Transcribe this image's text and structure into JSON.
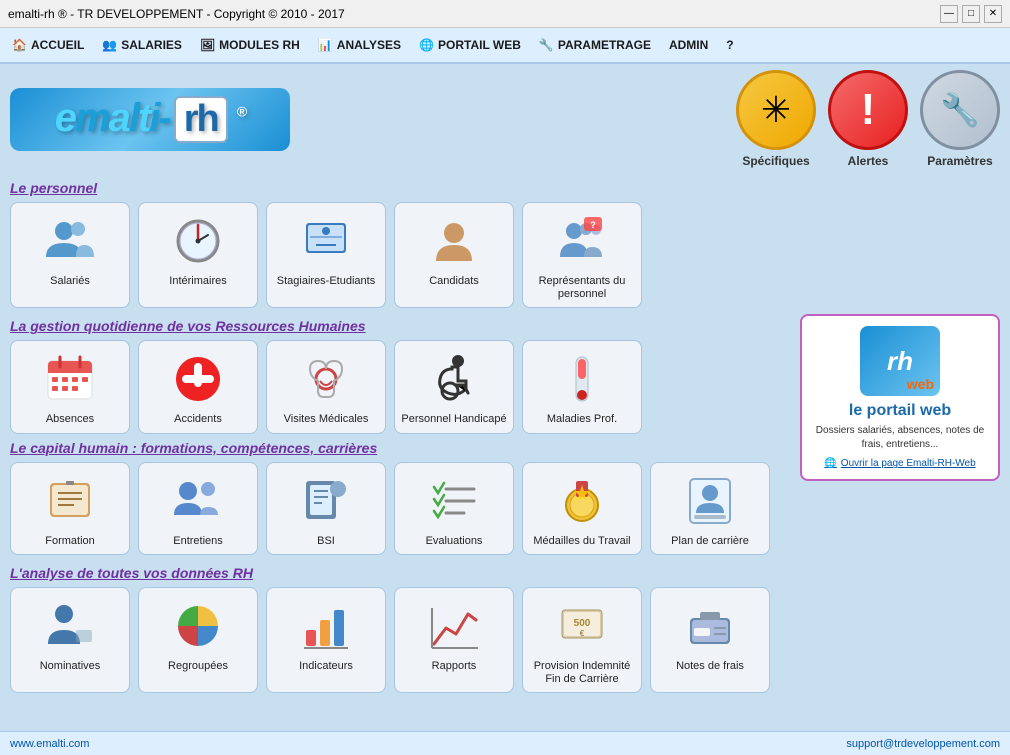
{
  "titlebar": {
    "title": "emalti-rh ® - TR DEVELOPPEMENT - Copyright © 2010 - 2017"
  },
  "titlebar_buttons": {
    "minimize": "—",
    "maximize": "□",
    "close": "✕"
  },
  "menu": {
    "items": [
      {
        "id": "accueil",
        "label": "ACCUEIL",
        "icon": "🏠"
      },
      {
        "id": "salaries",
        "label": "SALARIES",
        "icon": "👥"
      },
      {
        "id": "modules_rh",
        "label": "MODULES RH",
        "icon": "🖼"
      },
      {
        "id": "analyses",
        "label": "ANALYSES",
        "icon": "📊"
      },
      {
        "id": "portail_web",
        "label": "PORTAIL WEB",
        "icon": "🌐"
      },
      {
        "id": "parametrage",
        "label": "PARAMETRAGE",
        "icon": "🔧"
      },
      {
        "id": "admin",
        "label": "ADMIN",
        "icon": ""
      },
      {
        "id": "help",
        "label": "?",
        "icon": ""
      }
    ]
  },
  "quick_buttons": [
    {
      "id": "specifiques",
      "label": "Spécifiques",
      "icon": "✳",
      "class": "specifiques"
    },
    {
      "id": "alertes",
      "label": "Alertes",
      "icon": "❗",
      "class": "alertes"
    },
    {
      "id": "parametres",
      "label": "Paramètres",
      "icon": "🔧",
      "class": "parametres"
    }
  ],
  "sections": {
    "personnel": {
      "header": "Le personnel",
      "tiles": [
        {
          "id": "salaries",
          "label": "Salariés",
          "icon": "👥"
        },
        {
          "id": "interimaires",
          "label": "Intérimaires",
          "icon": "🕐"
        },
        {
          "id": "stagiaires",
          "label": "Stagiaires-Etudiants",
          "icon": "🎓"
        },
        {
          "id": "candidats",
          "label": "Candidats",
          "icon": "👤"
        },
        {
          "id": "representants",
          "label": "Représentants du personnel",
          "icon": "👥"
        }
      ]
    },
    "gestion": {
      "header": "La gestion quotidienne de vos Ressources Humaines",
      "tiles": [
        {
          "id": "absences",
          "label": "Absences",
          "icon": "📅"
        },
        {
          "id": "accidents",
          "label": "Accidents",
          "icon": "➕"
        },
        {
          "id": "visites",
          "label": "Visites Médicales",
          "icon": "🩺"
        },
        {
          "id": "handicape",
          "label": "Personnel Handicapé",
          "icon": "♿"
        },
        {
          "id": "maladies",
          "label": "Maladies Prof.",
          "icon": "🌡"
        }
      ]
    },
    "capital": {
      "header": "Le capital humain : formations, compétences, carrières",
      "tiles": [
        {
          "id": "formation",
          "label": "Formation",
          "icon": "📖"
        },
        {
          "id": "entretiens",
          "label": "Entretiens",
          "icon": "👥"
        },
        {
          "id": "bsi",
          "label": "BSI",
          "icon": "📚"
        },
        {
          "id": "evaluations",
          "label": "Evaluations",
          "icon": "✅"
        },
        {
          "id": "medailles",
          "label": "Médailles du Travail",
          "icon": "🏅"
        },
        {
          "id": "plan_carriere",
          "label": "Plan de carrière",
          "icon": "📋"
        }
      ]
    },
    "analyse": {
      "header": "L'analyse de toutes vos données RH",
      "tiles": [
        {
          "id": "nominatives",
          "label": "Nominatives",
          "icon": "👤"
        },
        {
          "id": "regroupees",
          "label": "Regroupées",
          "icon": "📊"
        },
        {
          "id": "indicateurs",
          "label": "Indicateurs",
          "icon": "📊"
        },
        {
          "id": "rapports",
          "label": "Rapports",
          "icon": "📈"
        },
        {
          "id": "provision",
          "label": "Provision Indemnité Fin de Carrière",
          "icon": "💰"
        },
        {
          "id": "notes_frais",
          "label": "Notes de frais",
          "icon": "💳"
        }
      ]
    }
  },
  "portail": {
    "title": "le portail web",
    "description": "Dossiers salariés, absences, notes de frais, entretiens...",
    "link_label": "Ouvrir la page Emalti-RH-Web"
  },
  "footer": {
    "left": "www.emalti.com",
    "right": "support@trdeveloppement.com"
  }
}
